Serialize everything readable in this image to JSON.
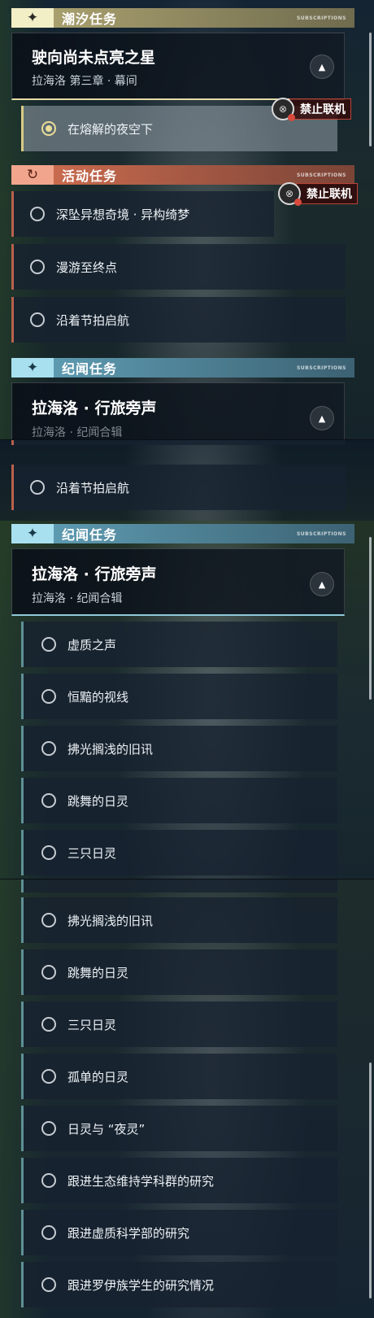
{
  "section_headers": {
    "tide": {
      "badge": "✦",
      "label": "潮汐任务"
    },
    "event": {
      "badge": "↻",
      "label": "活动任务"
    },
    "chronicle": {
      "badge": "✦",
      "label": "纪闻任务"
    }
  },
  "tide_card": {
    "title": "驶向尚未点亮之星",
    "subtitle": "拉海洛 第三章 · 幕间"
  },
  "tide_items": [
    "在熔解的夜空下"
  ],
  "online_badge": "禁止联机",
  "event_items": [
    "深坠异想奇境 · 异构绮梦",
    "漫游至终点",
    "沿着节拍启航"
  ],
  "chronicle_card": {
    "title": "拉海洛 · 行旅旁声",
    "subtitle": "拉海洛 · 纪闻合辑",
    "subtitle_cut": "拉海洛 · 纪闻合辑"
  },
  "chronicle_items": [
    "虚质之声",
    "恒黯的视线",
    "拂光搁浅的旧讯",
    "跳舞的日灵",
    "三只日灵",
    "孤单的日灵",
    "日灵与 “夜灵”",
    "跟进生态维持学科群的研究",
    "跟进虚质科学部的研究",
    "跟进罗伊族学生的研究情况"
  ],
  "header_small_text": "SUBSCRIPTIONS",
  "arrow_icon": "chevron-up-icon"
}
